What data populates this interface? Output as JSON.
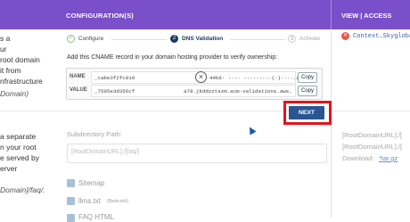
{
  "header": {
    "title": "CONFIGURATION(S)",
    "right_title": "VIEW | ACCESS"
  },
  "left_col": {
    "lines": [
      "s a",
      "ur",
      "root domain",
      "it from",
      "nfrastructure",
      "Domain)"
    ],
    "lines2": [
      "a separate",
      "n your root",
      "e served by",
      "erver",
      "Domain]/faq/."
    ]
  },
  "steps": {
    "step1": "Configure",
    "step2": "DNS Validation",
    "step2_num": "2",
    "step3": "Activate",
    "step3_num": "3"
  },
  "instruction": "Add this CNAME record in your domain hosting provider to verify ownership:",
  "records": [
    {
      "label": "NAME",
      "value": "_cabe3f2fc019",
      "value_right": "44b6· ···· ·········(·)····.ai.",
      "copy": "Copy"
    },
    {
      "label": "VALUE",
      "value": "_7595e3d356cf",
      "value_right": "a79.jkddzztszm.acm-validations.aws.",
      "copy": "Copy"
    }
  ],
  "next_label": "NEXT",
  "subdirectory": {
    "label": "Subdirectory Path:",
    "placeholder": "[RootDomainURL]:/[faq/]"
  },
  "checkboxes": [
    {
      "label": "Sitemap",
      "note": ""
    },
    {
      "label": "llms.txt",
      "note": "(Beta-ish)"
    },
    {
      "label": "FAQ HTML",
      "note": ""
    }
  ],
  "right_panel": {
    "status_link": "Context.Skyglobal",
    "line1": "[RootDomainURL]:/[",
    "line2": "[RootDomainURL]:/[",
    "download_label": "Download:",
    "download_link": "*tar.gz"
  },
  "colors": {
    "header_bg": "#7a4fc9",
    "next_bg": "#2b5593",
    "highlight": "#e0141c"
  }
}
